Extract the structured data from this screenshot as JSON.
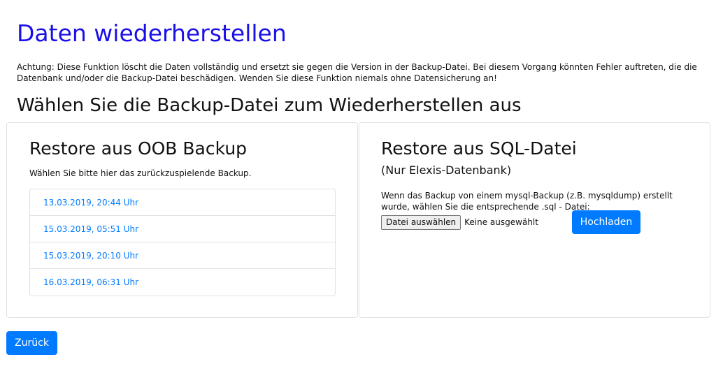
{
  "page": {
    "title": "Daten wiederherstellen",
    "warning": "Achtung: Diese Funktion löscht die Daten vollständig und ersetzt sie gegen die Version in der Backup-Datei. Bei diesem Vorgang könnten Fehler auftreten, die die Datenbank und/oder die Backup-Datei beschädigen. Wenden Sie diese Funktion niemals ohne Datensicherung an!",
    "subtitle": "Wählen Sie die Backup-Datei zum Wiederherstellen aus"
  },
  "oob_card": {
    "title": "Restore aus OOB Backup",
    "instruction": "Wählen Sie bitte hier das zurückzuspielende Backup.",
    "backups": [
      {
        "label": "13.03.2019, 20:44 Uhr"
      },
      {
        "label": "15.03.2019, 05:51 Uhr"
      },
      {
        "label": "15.03.2019, 20:10 Uhr"
      },
      {
        "label": "16.03.2019, 06:31 Uhr"
      }
    ]
  },
  "sql_card": {
    "title": "Restore aus SQL-Datei",
    "subtitle": "(Nur Elexis-Datenbank)",
    "instruction": "Wenn das Backup von einem mysql-Backup (z.B. mysqldump) erstellt wurde, wählen Sie die entsprechende .sql - Datei:",
    "file_button_label": "Datei auswählen",
    "file_status": "Keine ausgewählt",
    "upload_label": "Hochladen"
  },
  "footer": {
    "back_label": "Zurück"
  },
  "colors": {
    "title": "#1a10e8",
    "link": "#007bff",
    "primary_button": "#007bff"
  }
}
